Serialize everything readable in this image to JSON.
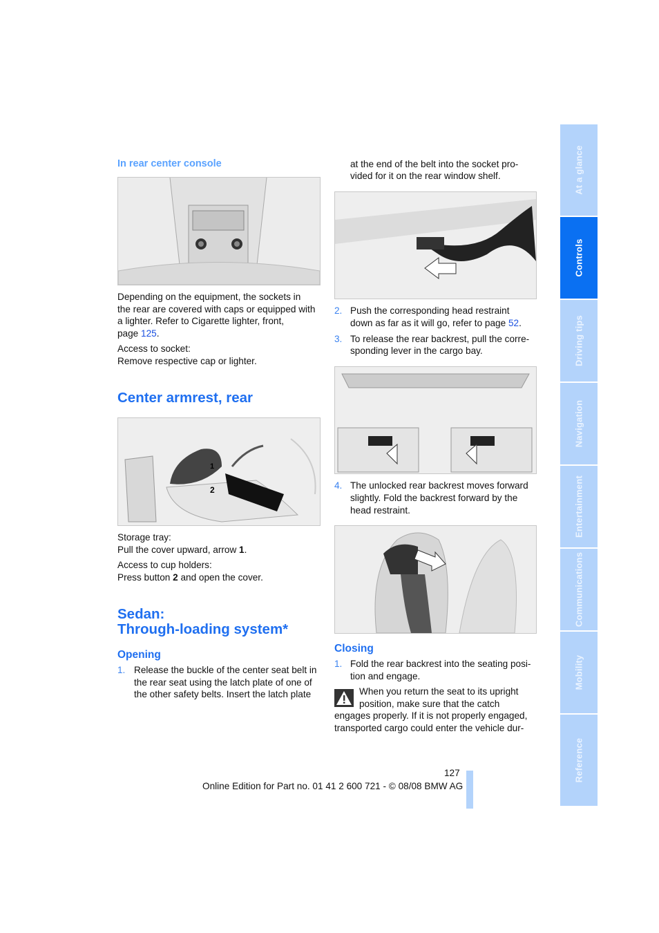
{
  "left": {
    "subheading": "In rear center console",
    "sockets_lines": [
      "Depending on the equipment, the sockets in",
      "the rear are covered with caps or equipped with",
      "a lighter. Refer to Cigarette lighter, front,"
    ],
    "sockets_page_prefix": "page ",
    "sockets_page_link": "125",
    "sockets_page_suffix": ".",
    "access_socket": "Access to socket:",
    "remove_cap": "Remove respective cap or lighter.",
    "armrest_heading": "Center armrest, rear",
    "storage_tray": "Storage tray:",
    "pull_cover_prefix": "Pull the cover upward, arrow ",
    "pull_cover_bold": "1",
    "pull_cover_suffix": ".",
    "cup_holders": "Access to cup holders:",
    "press_button_prefix": "Press button ",
    "press_button_bold": "2",
    "press_button_suffix": " and open the cover.",
    "sedan_heading_1": "Sedan:",
    "sedan_heading_2": "Through-loading system*",
    "opening_heading": "Opening",
    "step1_num": "1.",
    "step1_lines": [
      "Release the buckle of the center seat belt in",
      "the rear seat using the latch plate of one of",
      "the other safety belts. Insert the latch plate"
    ],
    "armrest_labels": [
      "1",
      "2"
    ]
  },
  "right": {
    "cont_lines": [
      "at the end of the belt into the socket pro-",
      "vided for it on the rear window shelf."
    ],
    "step2_num": "2.",
    "step2_line1": "Push the corresponding head restraint",
    "step2_line2_prefix": "down as far as it will go, refer to page ",
    "step2_link": "52",
    "step2_suffix": ".",
    "step3_num": "3.",
    "step3_lines": [
      "To release the rear backrest, pull the corre-",
      "sponding lever in the cargo bay."
    ],
    "step4_num": "4.",
    "step4_lines": [
      "The unlocked rear backrest moves forward",
      "slightly. Fold the backrest forward by the",
      "head restraint."
    ],
    "closing_heading": "Closing",
    "close1_num": "1.",
    "close1_lines": [
      "Fold the rear backrest into the seating posi-",
      "tion and engage."
    ],
    "warning_lines": [
      "When you return the seat to its upright",
      "position, make sure that the catch",
      "engages properly. If it is not properly engaged,",
      "transported cargo could enter the vehicle dur-"
    ],
    "warning_icon": "warning-triangle-icon"
  },
  "footer": {
    "page_number": "127",
    "edition": "Online Edition for Part no. 01 41 2 600 721 - © 08/08 BMW AG"
  },
  "tabs": [
    {
      "label": "At a glance",
      "active": false
    },
    {
      "label": "Controls",
      "active": true
    },
    {
      "label": "Driving tips",
      "active": false
    },
    {
      "label": "Navigation",
      "active": false
    },
    {
      "label": "Entertainment",
      "active": false
    },
    {
      "label": "Communications",
      "active": false
    },
    {
      "label": "Mobility",
      "active": false
    },
    {
      "label": "Reference",
      "active": false
    }
  ],
  "colors": {
    "accent": "#1f6ff0",
    "tab_active": "#0a70f2",
    "tab_inactive": "#b3d3fb"
  }
}
